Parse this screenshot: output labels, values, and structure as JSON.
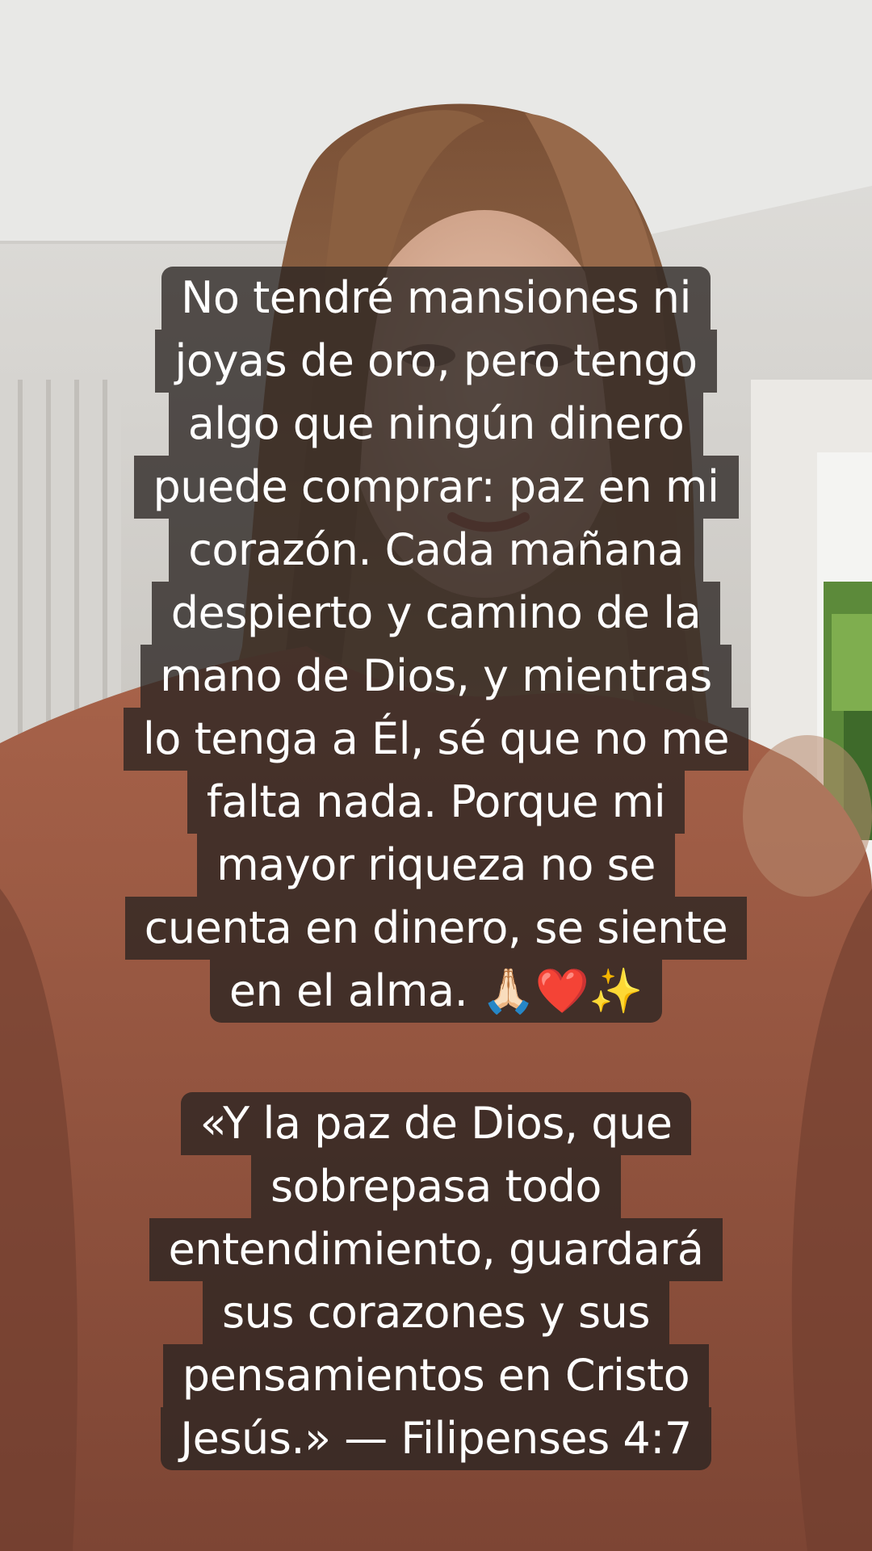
{
  "caption": {
    "lines": [
      "No tendré mansiones ni",
      "joyas de oro, pero tengo",
      "algo que ningún dinero",
      "puede comprar: paz en mi",
      "corazón. Cada mañana",
      "despierto y camino de la",
      "mano de Dios, y mientras",
      "lo tenga a Él, sé que no me",
      "falta nada. Porque mi",
      "mayor riqueza no se",
      "cuenta en dinero, se siente",
      "en el alma. 🙏🏻❤️✨"
    ]
  },
  "verse": {
    "lines": [
      "«Y la paz de Dios, que",
      "sobrepasa todo",
      "entendimiento, guardará",
      "sus corazones y sus",
      "pensamientos en Cristo",
      "Jesús.» — Filipenses 4:7"
    ]
  },
  "colors": {
    "caption_background": "#2a2421",
    "caption_text": "#ffffff",
    "wall": "#d9d6d1",
    "sweater": "#9c5a44",
    "hair": "#8a6142"
  }
}
